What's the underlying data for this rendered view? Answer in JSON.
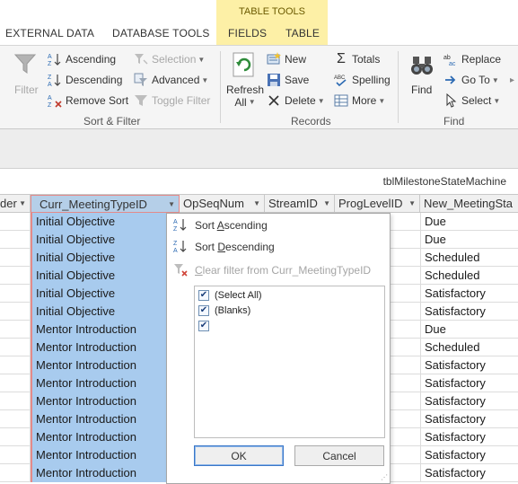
{
  "ribbon": {
    "context_title": "TABLE TOOLS",
    "tabs": [
      "EXTERNAL DATA",
      "DATABASE TOOLS",
      "FIELDS",
      "TABLE"
    ],
    "sort_filter": {
      "filter": "Filter",
      "ascending": "Ascending",
      "descending": "Descending",
      "remove_sort": "Remove Sort",
      "selection": "Selection",
      "advanced": "Advanced",
      "toggle_filter": "Toggle Filter",
      "group_label": "Sort & Filter"
    },
    "records": {
      "refresh_line1": "Refresh",
      "refresh_line2": "All",
      "new": "New",
      "save": "Save",
      "delete": "Delete",
      "totals": "Totals",
      "spelling": "Spelling",
      "more": "More",
      "group_label": "Records"
    },
    "find": {
      "find": "Find",
      "replace": "Replace",
      "goto": "Go To",
      "select": "Select",
      "group_label": "Find"
    }
  },
  "sheet": {
    "table_name": "tblMilestoneStateMachine",
    "columns": [
      "der",
      "Curr_MeetingTypeID",
      "OpSeqNum",
      "StreamID",
      "ProgLevelID",
      "New_MeetingSta"
    ],
    "rows": [
      {
        "curr": "Initial Objective",
        "new": "Due"
      },
      {
        "curr": "Initial Objective",
        "new": "Due"
      },
      {
        "curr": "Initial Objective",
        "new": "Scheduled"
      },
      {
        "curr": "Initial Objective",
        "new": "Scheduled"
      },
      {
        "curr": "Initial Objective",
        "new": "Satisfactory"
      },
      {
        "curr": "Initial Objective",
        "new": "Satisfactory"
      },
      {
        "curr": "Mentor Introduction",
        "new": "Due"
      },
      {
        "curr": "Mentor Introduction",
        "new": "Scheduled"
      },
      {
        "curr": "Mentor Introduction",
        "new": "Satisfactory"
      },
      {
        "curr": "Mentor Introduction",
        "new": "Satisfactory"
      },
      {
        "curr": "Mentor Introduction",
        "new": "Satisfactory"
      },
      {
        "curr": "Mentor Introduction",
        "new": "Satisfactory"
      },
      {
        "curr": "Mentor Introduction",
        "new": "Satisfactory"
      },
      {
        "curr": "Mentor Introduction",
        "new": "Satisfactory"
      },
      {
        "curr": "Mentor Introduction",
        "new": "Satisfactory"
      }
    ]
  },
  "filter_menu": {
    "sort_ascending_pre": "Sort ",
    "sort_ascending_key": "A",
    "sort_ascending_post": "scending",
    "sort_descending_pre": "Sort ",
    "sort_descending_key": "D",
    "sort_descending_post": "escending",
    "clear_key": "C",
    "clear_post": "lear filter from Curr_MeetingTypeID",
    "checklist": [
      {
        "label": "(Select All)",
        "checked": true
      },
      {
        "label": "(Blanks)",
        "checked": true
      },
      {
        "label": "",
        "checked": true
      }
    ],
    "ok": "OK",
    "cancel": "Cancel"
  }
}
